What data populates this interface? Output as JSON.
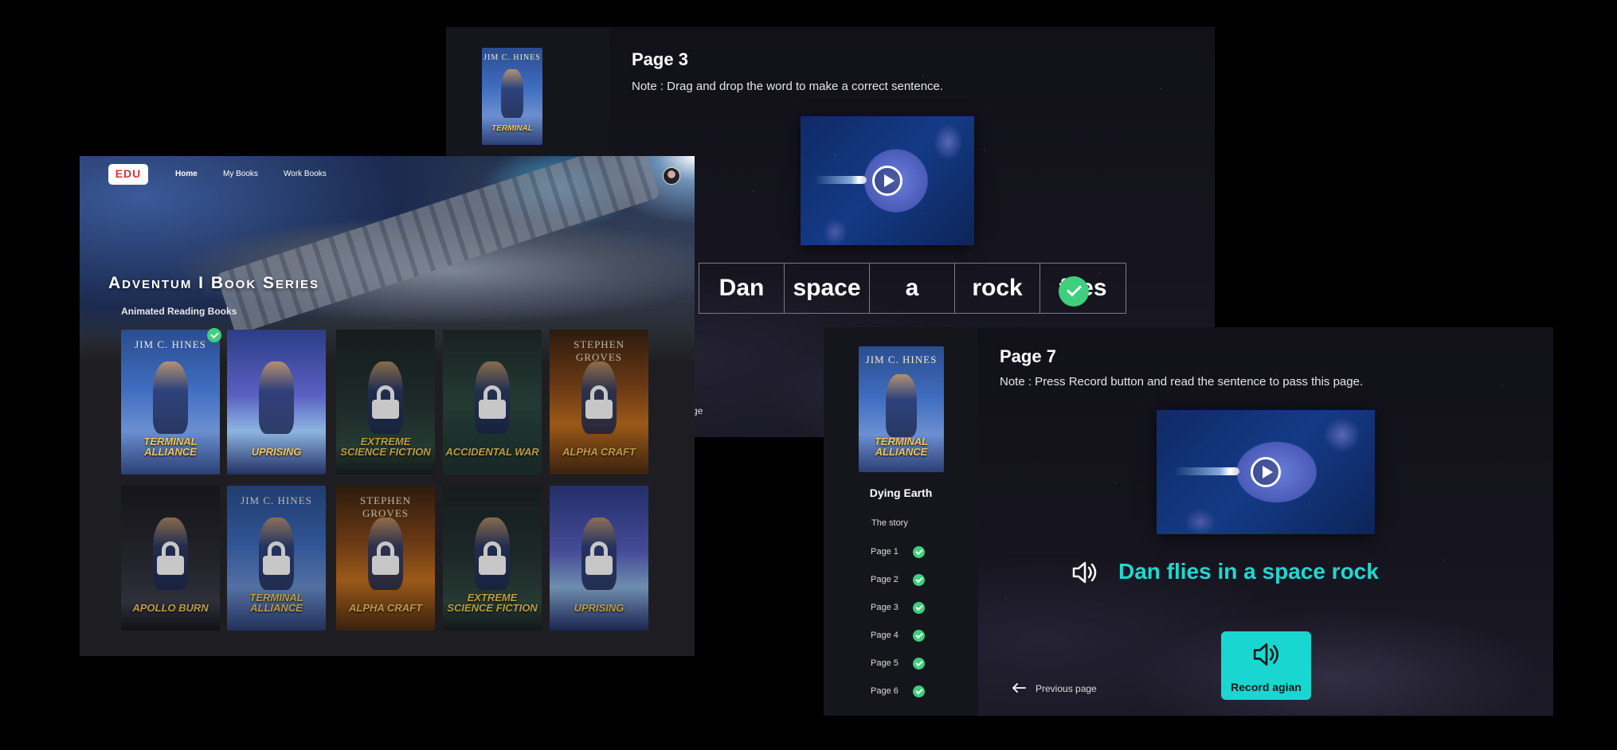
{
  "page3": {
    "title": "Page 3",
    "note": "Note : Drag and drop the word to make a correct sentence.",
    "words": [
      "Dan",
      "space",
      "a",
      "rock",
      "flies"
    ],
    "previous_partial": "ous page"
  },
  "home": {
    "logo": "EDU",
    "nav": [
      "Home",
      "My Books",
      "Work Books"
    ],
    "series_title": "Adventum I Book Series",
    "section_label": "Animated Reading Books",
    "books": [
      {
        "author": "JIM C. HINES",
        "title": "TERMINAL ALLIANCE",
        "style": "terminal",
        "locked": false,
        "done": true
      },
      {
        "author": "",
        "title": "UPRISING",
        "style": "uprising",
        "locked": false,
        "done": false
      },
      {
        "author": "",
        "title": "EXTREME SCIENCE FICTION",
        "style": "extreme",
        "locked": true,
        "done": false
      },
      {
        "author": "",
        "title": "ACCIDENTAL WAR",
        "style": "accident",
        "locked": true,
        "done": false
      },
      {
        "author": "STEPHEN GROVES",
        "title": "ALPHA CRAFT",
        "style": "alpha",
        "locked": true,
        "done": false
      },
      {
        "author": "",
        "title": "APOLLO BURN",
        "style": "apollo",
        "locked": true,
        "done": false
      },
      {
        "author": "JIM C. HINES",
        "title": "TERMINAL ALLIANCE",
        "style": "terminal",
        "locked": true,
        "done": false
      },
      {
        "author": "STEPHEN GROVES",
        "title": "ALPHA CRAFT",
        "style": "alpha",
        "locked": true,
        "done": false
      },
      {
        "author": "",
        "title": "EXTREME SCIENCE FICTION",
        "style": "extreme",
        "locked": true,
        "done": false
      },
      {
        "author": "",
        "title": "UPRISING",
        "style": "uprising",
        "locked": true,
        "done": false
      }
    ]
  },
  "page7": {
    "book_name": "Dying Earth",
    "story_link": "The story",
    "pages": [
      "Page 1",
      "Page 2",
      "Page 3",
      "Page 4",
      "Page 5",
      "Page 6"
    ],
    "title": "Page 7",
    "note": "Note : Press Record button and read the sentence to pass this page.",
    "sentence": "Dan flies in a space rock",
    "record_label": "Record agian",
    "previous_label": "Previous page"
  },
  "colors": {
    "accent": "#19d7d0",
    "success": "#3fcf7d",
    "background": "#000000"
  },
  "icons": [
    "play-icon",
    "check-icon",
    "lock-icon",
    "speaker-icon",
    "arrow-left-icon"
  ]
}
